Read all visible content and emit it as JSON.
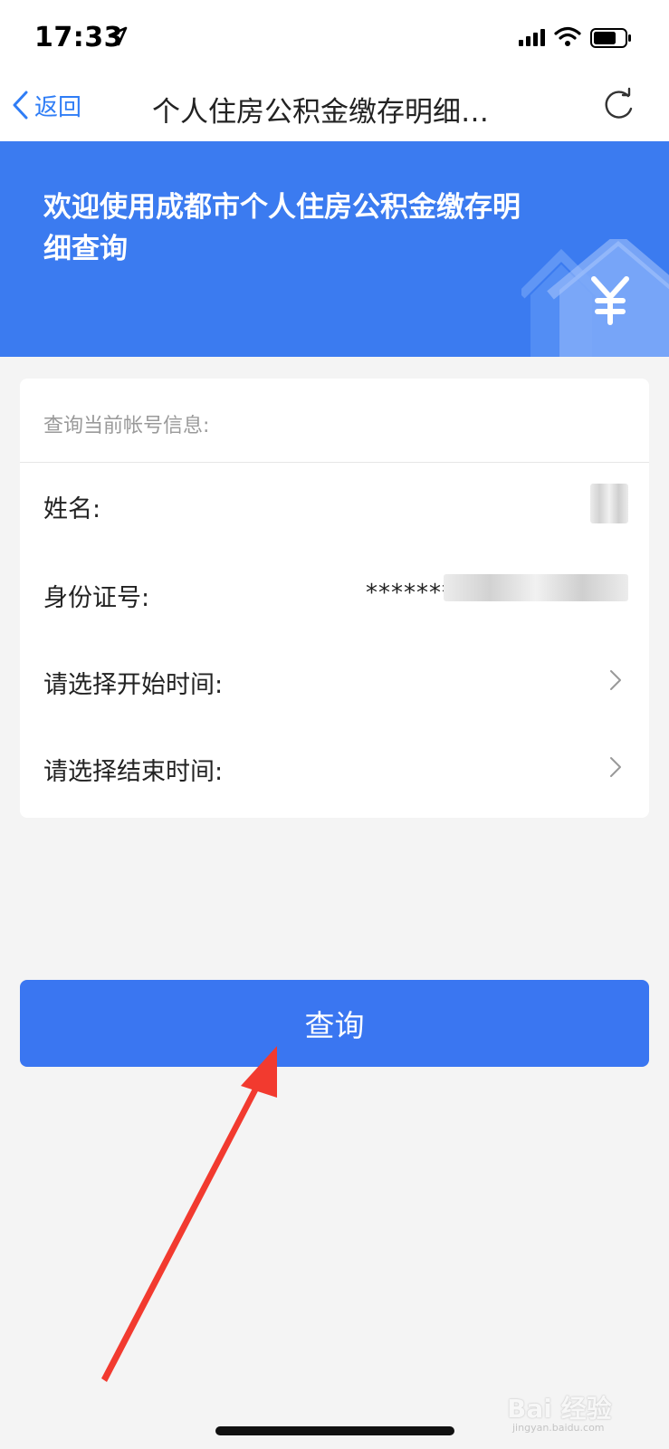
{
  "status_bar": {
    "time": "17:33"
  },
  "nav": {
    "back_label": "返回",
    "title": "个人住房公积金缴存明细…"
  },
  "banner": {
    "title": "欢迎使用成都市个人住房公积金缴存明细查询"
  },
  "card": {
    "header": "查询当前帐号信息:",
    "rows": [
      {
        "label": "姓名:"
      },
      {
        "label": "身份证号:",
        "value": "*******"
      },
      {
        "label": "请选择开始时间:"
      },
      {
        "label": "请选择结束时间:"
      }
    ]
  },
  "query_button": {
    "label": "查询"
  },
  "watermark": {
    "logo": "Bai 经验",
    "sub": "jingyan.baidu.com"
  },
  "colors": {
    "accent": "#3a76f1",
    "banner": "#3b7bf0",
    "annotation_arrow": "#f23a2f"
  }
}
